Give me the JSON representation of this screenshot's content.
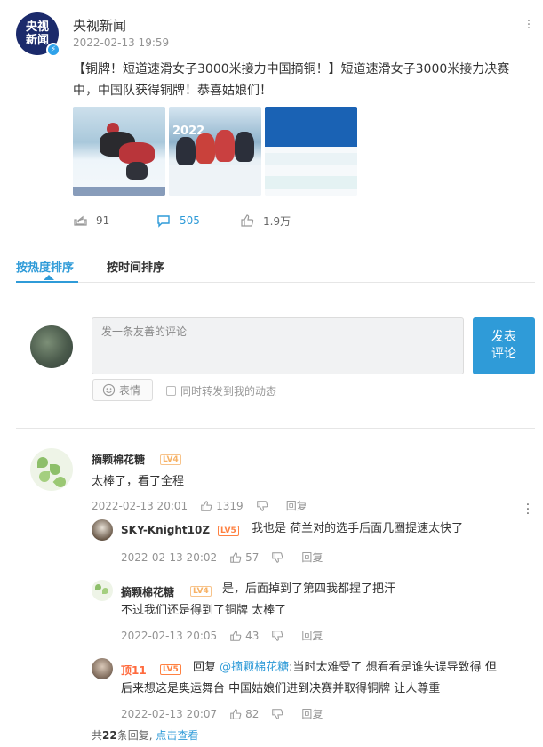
{
  "post": {
    "avatar_text_line1": "央视",
    "avatar_text_line2": "新闻",
    "author": "央视新闻",
    "time": "2022-02-13 19:59",
    "text": "【铜牌！短道速滑女子3000米接力中国摘铜！】短道速滑女子3000米接力决赛中，中国队获得铜牌！恭喜姑娘们！",
    "actions": {
      "repost_count": "91",
      "comment_count": "505",
      "like_count": "1.9万"
    }
  },
  "tabs": {
    "hot": "按热度排序",
    "time": "按时间排序"
  },
  "composer": {
    "placeholder": "发一条友善的评论",
    "submit_line1": "发表",
    "submit_line2": "评论",
    "emoji_label": "表情",
    "repost_label": "同时转发到我的动态"
  },
  "comments": [
    {
      "name": "摘颗棉花糖",
      "level": "LV4",
      "text": "太棒了，看了全程",
      "time": "2022-02-13 20:01",
      "likes": "1319",
      "reply_label": "回复",
      "replies": [
        {
          "name": "SKY-Knight10Z",
          "level": "LV5",
          "text": "我也是 荷兰对的选手后面几圈提速太快了",
          "time": "2022-02-13 20:02",
          "likes": "57",
          "reply_label": "回复"
        },
        {
          "name": "摘颗棉花糖",
          "level": "LV4",
          "text_line1": "是，后面掉到了第四我都捏了把汗",
          "text_line2": "不过我们还是得到了铜牌 太棒了",
          "time": "2022-02-13 20:05",
          "likes": "43",
          "reply_label": "回复"
        },
        {
          "name": "顶11",
          "level": "LV5",
          "reply_prefix": "回复",
          "mention": "@摘颗棉花糖",
          "text_line1": ":当时太难受了 想看看是谁失误导致得 但",
          "text_line2": "后来想这是奥运舞台 中国姑娘们进到决赛并取得铜牌 让人尊重",
          "time": "2022-02-13 20:07",
          "likes": "82",
          "reply_label": "回复"
        }
      ],
      "total_prefix": "共",
      "total_count": "22",
      "total_suffix": "条回复,",
      "view_link": "点击查看"
    }
  ],
  "colors": {
    "accent": "#2f9bd8",
    "level_gold": "#f7b266",
    "level_orange": "#ff8141"
  }
}
